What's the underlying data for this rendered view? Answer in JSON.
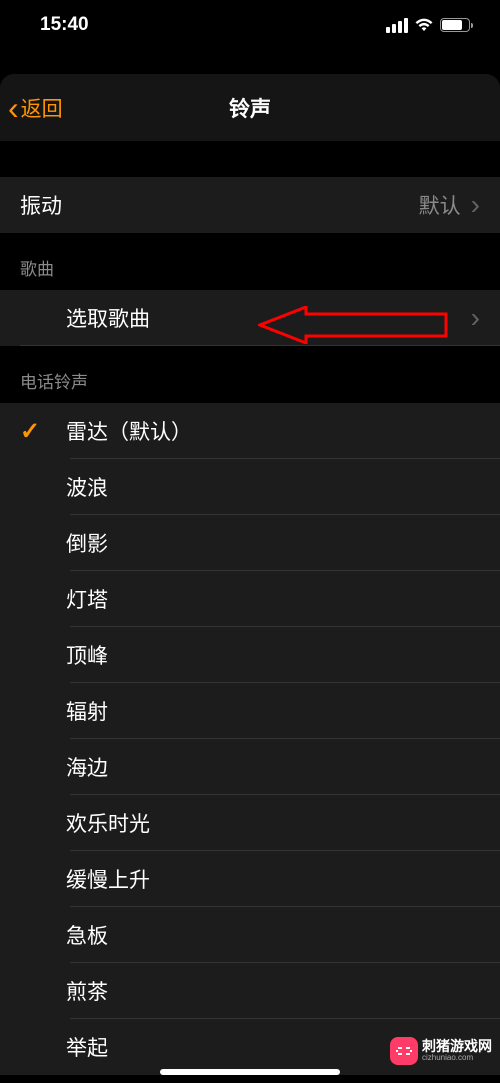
{
  "status": {
    "time": "15:40"
  },
  "header": {
    "back_label": "返回",
    "title": "铃声"
  },
  "vibration": {
    "label": "振动",
    "value": "默认"
  },
  "songs_section": {
    "header": "歌曲",
    "pick_label": "选取歌曲"
  },
  "ringtones_section": {
    "header": "电话铃声",
    "items": [
      {
        "label": "雷达（默认）",
        "selected": true
      },
      {
        "label": "波浪",
        "selected": false
      },
      {
        "label": "倒影",
        "selected": false
      },
      {
        "label": "灯塔",
        "selected": false
      },
      {
        "label": "顶峰",
        "selected": false
      },
      {
        "label": "辐射",
        "selected": false
      },
      {
        "label": "海边",
        "selected": false
      },
      {
        "label": "欢乐时光",
        "selected": false
      },
      {
        "label": "缓慢上升",
        "selected": false
      },
      {
        "label": "急板",
        "selected": false
      },
      {
        "label": "煎茶",
        "selected": false
      },
      {
        "label": "举起",
        "selected": false
      }
    ]
  },
  "watermark": {
    "name": "刺猪游戏网",
    "url": "cizhuniao.com"
  }
}
